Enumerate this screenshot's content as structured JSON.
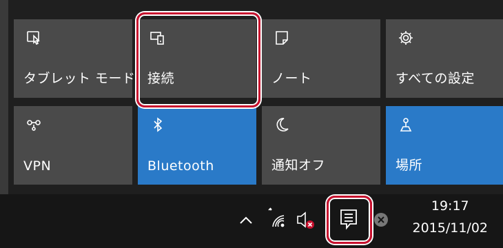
{
  "tiles": [
    {
      "label": "タブレット モード",
      "icon": "tablet-mode-icon",
      "active": false
    },
    {
      "label": "接続",
      "icon": "connect-icon",
      "active": false
    },
    {
      "label": "ノート",
      "icon": "note-icon",
      "active": false
    },
    {
      "label": "すべての設定",
      "icon": "gear-icon",
      "active": false
    },
    {
      "label": "VPN",
      "icon": "vpn-icon",
      "active": false
    },
    {
      "label": "Bluetooth",
      "icon": "bluetooth-icon",
      "active": true
    },
    {
      "label": "通知オフ",
      "icon": "moon-icon",
      "active": false
    },
    {
      "label": "場所",
      "icon": "location-icon",
      "active": true
    }
  ],
  "taskbar": {
    "time": "19:17",
    "date": "2015/11/02"
  },
  "colors": {
    "tile": "#4a4a4a",
    "tile_active": "#2a7ac8",
    "highlight": "#c8102e",
    "taskbar": "#161616"
  }
}
